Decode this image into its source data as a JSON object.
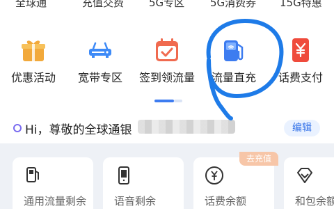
{
  "top_menu": [
    {
      "label": "全球通"
    },
    {
      "label": "充值交费"
    },
    {
      "label": "5G专区"
    },
    {
      "label": "5G消费券"
    },
    {
      "label": "15G特惠"
    }
  ],
  "quick_actions": [
    {
      "label": "优惠活动",
      "icon": "gift-icon",
      "color": "#f2a93b"
    },
    {
      "label": "宽带专区",
      "icon": "router-icon",
      "color": "#3d8af7"
    },
    {
      "label": "签到领流量",
      "icon": "calendar-check-icon",
      "color": "#f06a4f"
    },
    {
      "label": "流量直充",
      "icon": "data-charger-icon",
      "color": "#3d7cf0"
    },
    {
      "label": "话费支付",
      "icon": "yuan-card-icon",
      "color": "#ef4b3c"
    }
  ],
  "greeting": {
    "text": "Hi，尊敬的全球通银",
    "edit_label": "编辑"
  },
  "cards": [
    {
      "label": "通用流量剩余",
      "icon": "data-charger-icon"
    },
    {
      "label": "语音剩余",
      "icon": "phone-icon"
    },
    {
      "label": "话费余额",
      "icon": "yuan-coin-icon",
      "tag": "去充值"
    },
    {
      "label": "和包余额",
      "icon": "diamond-icon"
    }
  ],
  "colors": {
    "accent": "#2f6fe8",
    "annotation": "#1e7be8"
  }
}
